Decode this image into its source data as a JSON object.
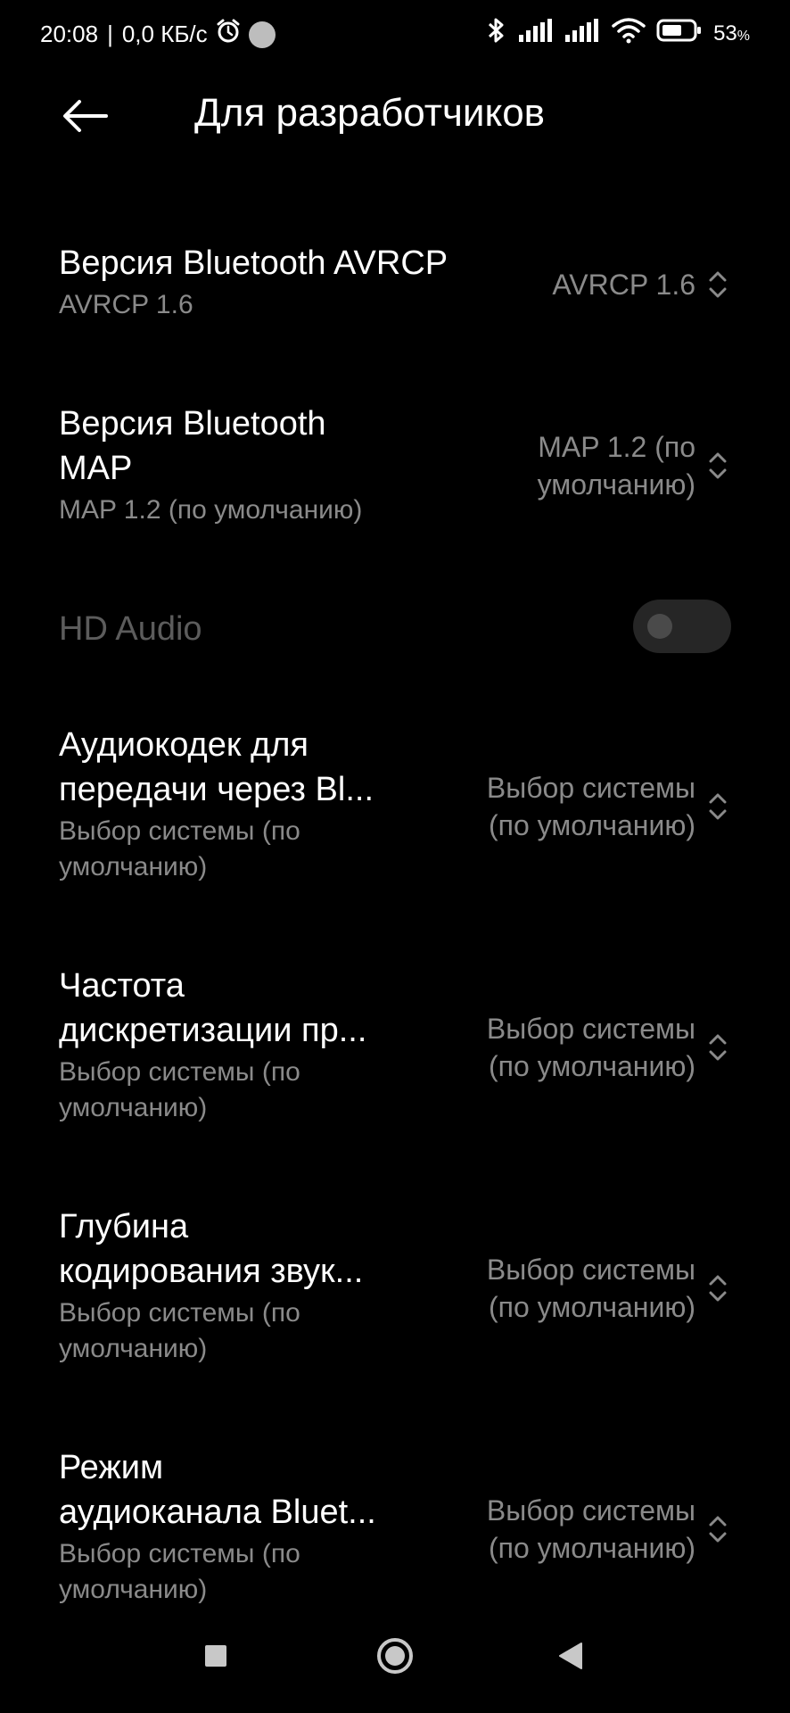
{
  "status_bar": {
    "time": "20:08",
    "separator": "|",
    "network_speed": "0,0 КБ/с",
    "battery_percent": "53",
    "battery_unit": "%",
    "icons": [
      "alarm-icon",
      "lounge-fm-icon",
      "bluetooth-icon",
      "signal-icon",
      "signal-icon",
      "wifi-icon",
      "battery-icon"
    ]
  },
  "app_bar": {
    "title": "Для разработчиков",
    "back_icon": "arrow-left-icon"
  },
  "settings": [
    {
      "title": "Версия Bluetooth AVRCP",
      "subtitle": "AVRCP 1.6",
      "value": "AVRCP 1.6"
    },
    {
      "title_line1": "Версия Bluetooth",
      "title_line2": "MAP",
      "subtitle": "MAP 1.2 (по умолчанию)",
      "value_line1": "MAP 1.2 (по",
      "value_line2": "умолчанию)"
    },
    {
      "title": "HD Audio",
      "enabled": false,
      "toggle_on": false
    },
    {
      "title_line1": "Аудиокодек для",
      "title_line2": "передачи через Bl...",
      "subtitle_line1": "Выбор системы (по",
      "subtitle_line2": "умолчанию)",
      "value_line1": "Выбор системы",
      "value_line2": "(по умолчанию)"
    },
    {
      "title_line1": "Частота",
      "title_line2": "дискретизации пр...",
      "subtitle_line1": "Выбор системы (по",
      "subtitle_line2": "умолчанию)",
      "value_line1": "Выбор системы",
      "value_line2": "(по умолчанию)"
    },
    {
      "title_line1": "Глубина",
      "title_line2": "кодирования звук...",
      "subtitle_line1": "Выбор системы (по",
      "subtitle_line2": "умолчанию)",
      "value_line1": "Выбор системы",
      "value_line2": "(по умолчанию)"
    },
    {
      "title_line1": "Режим",
      "title_line2": "аудиоканала Bluet...",
      "subtitle_line1": "Выбор системы (по",
      "subtitle_line2": "умолчанию)",
      "value_line1": "Выбор системы",
      "value_line2": "(по умолчанию)"
    }
  ],
  "nav_bar": {
    "icons": [
      "recents-square-icon",
      "home-circle-icon",
      "back-triangle-icon"
    ]
  },
  "colors": {
    "background": "#000000",
    "primary_text": "#ffffff",
    "secondary_text": "#8a8a8a",
    "disabled_text": "#5c5c5c",
    "toggle_track": "#262626"
  }
}
